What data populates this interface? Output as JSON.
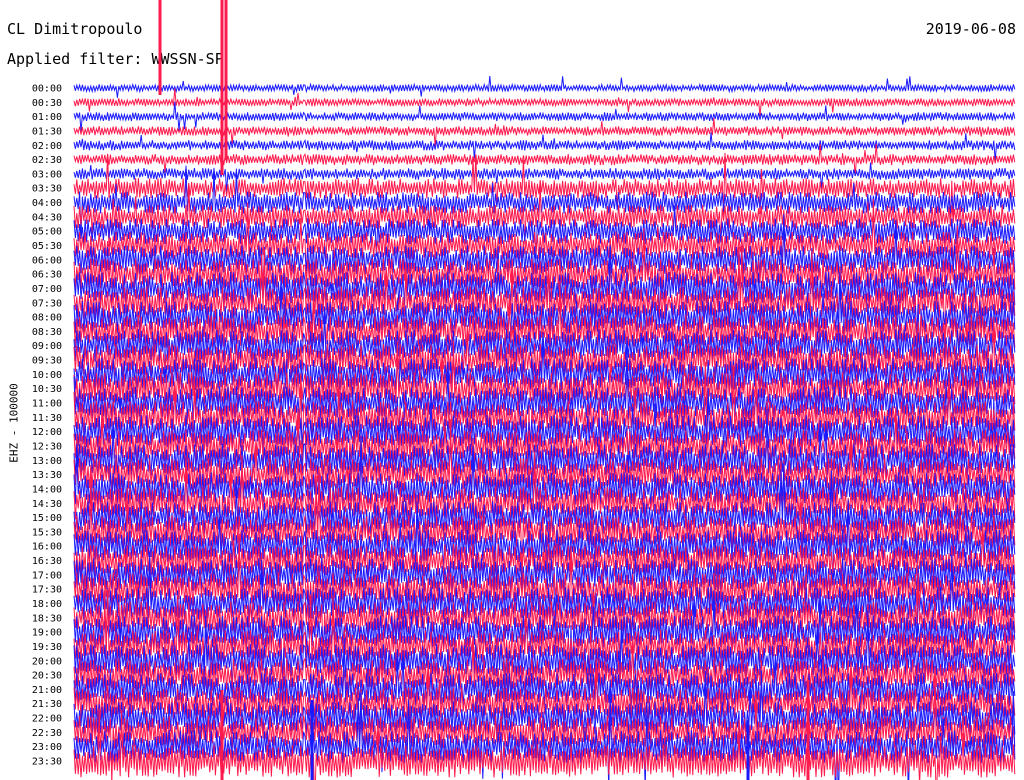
{
  "header": {
    "station": "CL Dimitropoulo",
    "filter": "Applied filter: WWSSN-SP",
    "date": "2019-06-08"
  },
  "channel_label": "EHZ - 100000",
  "colors": {
    "trace_a": "#1a1aff",
    "trace_b": "#ff1a4d",
    "background": "#ffffff"
  },
  "chart_data": {
    "type": "line",
    "title": "",
    "xlabel": "",
    "ylabel": "EHZ - 100000",
    "row_labels": [
      "00:00",
      "00:30",
      "01:00",
      "01:30",
      "02:00",
      "02:30",
      "03:00",
      "03:30",
      "04:00",
      "04:30",
      "05:00",
      "05:30",
      "06:00",
      "06:30",
      "07:00",
      "07:30",
      "08:00",
      "08:30",
      "09:00",
      "09:30",
      "10:00",
      "10:30",
      "11:00",
      "11:30",
      "12:00",
      "12:30",
      "13:00",
      "13:30",
      "14:00",
      "14:30",
      "15:00",
      "15:30",
      "16:00",
      "16:30",
      "17:00",
      "17:30",
      "18:00",
      "18:30",
      "19:00",
      "19:30",
      "20:00",
      "20:30",
      "21:00",
      "21:30",
      "22:00",
      "22:30",
      "23:00",
      "23:30"
    ],
    "series": [
      {
        "color": "#1a1aff",
        "rows": "even"
      },
      {
        "color": "#ff1a4d",
        "rows": "odd"
      }
    ],
    "grid": false
  }
}
